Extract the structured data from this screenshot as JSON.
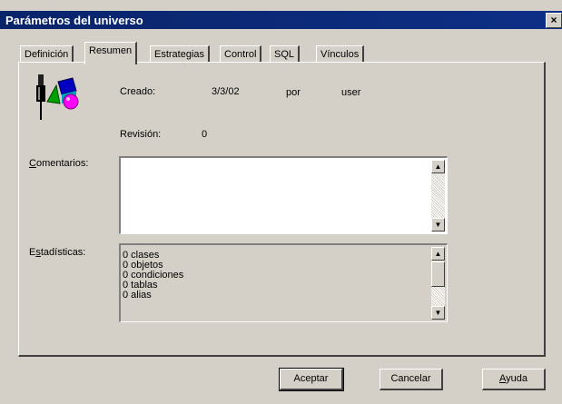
{
  "window": {
    "title": "Parámetros del universo",
    "close_symbol": "×"
  },
  "tabs": [
    {
      "label": "Definición",
      "active": false
    },
    {
      "label": "Resumen",
      "active": true
    },
    {
      "label": "Estrategias",
      "active": false
    },
    {
      "label": "Control",
      "active": false
    },
    {
      "label": "SQL",
      "active": false
    },
    {
      "label": "Vínculos",
      "active": false
    }
  ],
  "summary": {
    "icon": "universe-shapes-icon",
    "created_label": "Creado:",
    "created_date": "3/3/02",
    "by_label": "por",
    "author": "user",
    "revision_label": "Revisión:",
    "revision_value": "0"
  },
  "comments": {
    "label": "Comentarios:",
    "value": ""
  },
  "stats": {
    "label": "Estadísticas:",
    "items": [
      "0 clases",
      "0 objetos",
      "0 condiciones",
      "0 tablas",
      "0 alias"
    ]
  },
  "buttons": {
    "accept": "Aceptar",
    "cancel": "Cancelar",
    "help": "Ayuda"
  }
}
